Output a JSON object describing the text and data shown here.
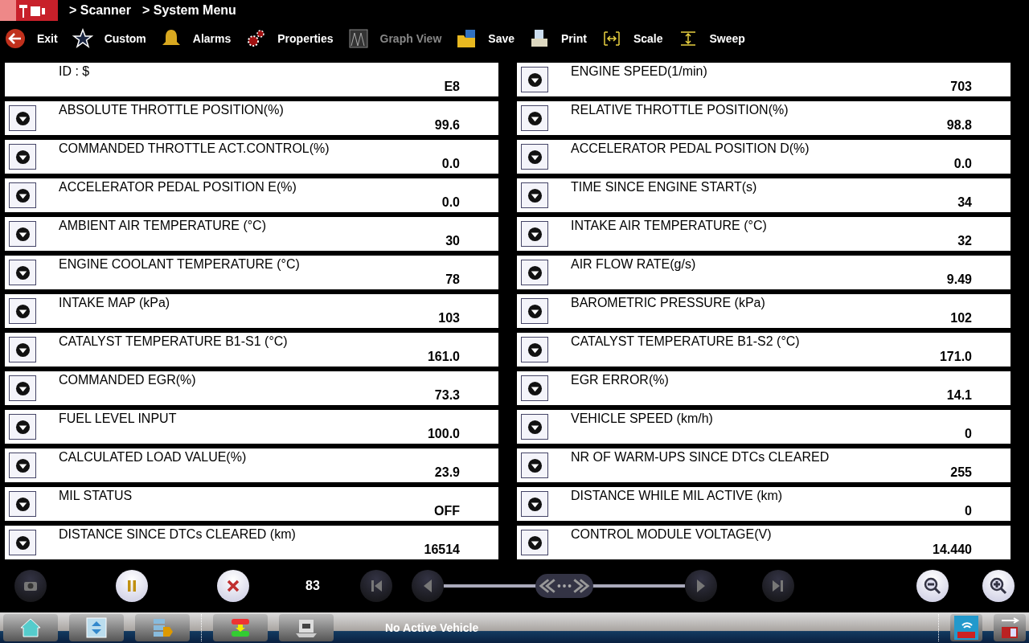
{
  "breadcrumb": [
    "> Scanner",
    "> System Menu"
  ],
  "toolbar": [
    {
      "kind": "exit",
      "label": "Exit",
      "disabled": false
    },
    {
      "kind": "custom",
      "label": "Custom",
      "disabled": false
    },
    {
      "kind": "alarms",
      "label": "Alarms",
      "disabled": false
    },
    {
      "kind": "properties",
      "label": "Properties",
      "disabled": false
    },
    {
      "kind": "graph",
      "label": "Graph View",
      "disabled": true
    },
    {
      "kind": "save",
      "label": "Save",
      "disabled": false
    },
    {
      "kind": "print",
      "label": "Print",
      "disabled": false
    },
    {
      "kind": "scale",
      "label": "Scale",
      "disabled": false
    },
    {
      "kind": "sweep",
      "label": "Sweep",
      "disabled": false
    }
  ],
  "parameters": [
    {
      "name": "ID : $",
      "value": "E8",
      "has_menu": false
    },
    {
      "name": "ENGINE SPEED(1/min)",
      "value": "703",
      "has_menu": true
    },
    {
      "name": "ABSOLUTE THROTTLE POSITION(%)",
      "value": "99.6",
      "has_menu": true
    },
    {
      "name": "RELATIVE THROTTLE POSITION(%)",
      "value": "98.8",
      "has_menu": true
    },
    {
      "name": "COMMANDED THROTTLE ACT.CONTROL(%)",
      "value": "0.0",
      "has_menu": true
    },
    {
      "name": "ACCELERATOR PEDAL POSITION D(%)",
      "value": "0.0",
      "has_menu": true
    },
    {
      "name": "ACCELERATOR PEDAL POSITION E(%)",
      "value": "0.0",
      "has_menu": true
    },
    {
      "name": "TIME SINCE ENGINE START(s)",
      "value": "34",
      "has_menu": true
    },
    {
      "name": "AMBIENT AIR TEMPERATURE (°C)",
      "value": "30",
      "has_menu": true
    },
    {
      "name": "INTAKE AIR TEMPERATURE (°C)",
      "value": "32",
      "has_menu": true
    },
    {
      "name": "ENGINE COOLANT TEMPERATURE (°C)",
      "value": "78",
      "has_menu": true
    },
    {
      "name": "AIR FLOW RATE(g/s)",
      "value": "9.49",
      "has_menu": true
    },
    {
      "name": "INTAKE MAP (kPa)",
      "value": "103",
      "has_menu": true
    },
    {
      "name": "BAROMETRIC PRESSURE (kPa)",
      "value": "102",
      "has_menu": true
    },
    {
      "name": "CATALYST TEMPERATURE B1-S1 (°C)",
      "value": "161.0",
      "has_menu": true
    },
    {
      "name": "CATALYST TEMPERATURE B1-S2 (°C)",
      "value": "171.0",
      "has_menu": true
    },
    {
      "name": "COMMANDED EGR(%)",
      "value": "73.3",
      "has_menu": true
    },
    {
      "name": "EGR ERROR(%)",
      "value": "14.1",
      "has_menu": true
    },
    {
      "name": "FUEL LEVEL INPUT",
      "value": "100.0",
      "has_menu": true
    },
    {
      "name": "VEHICLE SPEED (km/h)",
      "value": "0",
      "has_menu": true
    },
    {
      "name": "CALCULATED LOAD VALUE(%)",
      "value": "23.9",
      "has_menu": true
    },
    {
      "name": "NR OF WARM-UPS SINCE DTCs CLEARED",
      "value": "255",
      "has_menu": true
    },
    {
      "name": "MIL STATUS",
      "value": "OFF",
      "has_menu": true
    },
    {
      "name": "DISTANCE WHILE MIL ACTIVE (km)",
      "value": "0",
      "has_menu": true
    },
    {
      "name": "DISTANCE SINCE DTCs CLEARED (km)",
      "value": "16514",
      "has_menu": true
    },
    {
      "name": "CONTROL MODULE VOLTAGE(V)",
      "value": "14.440",
      "has_menu": true
    }
  ],
  "playback": {
    "frame": "83"
  },
  "status": "No Active Vehicle"
}
